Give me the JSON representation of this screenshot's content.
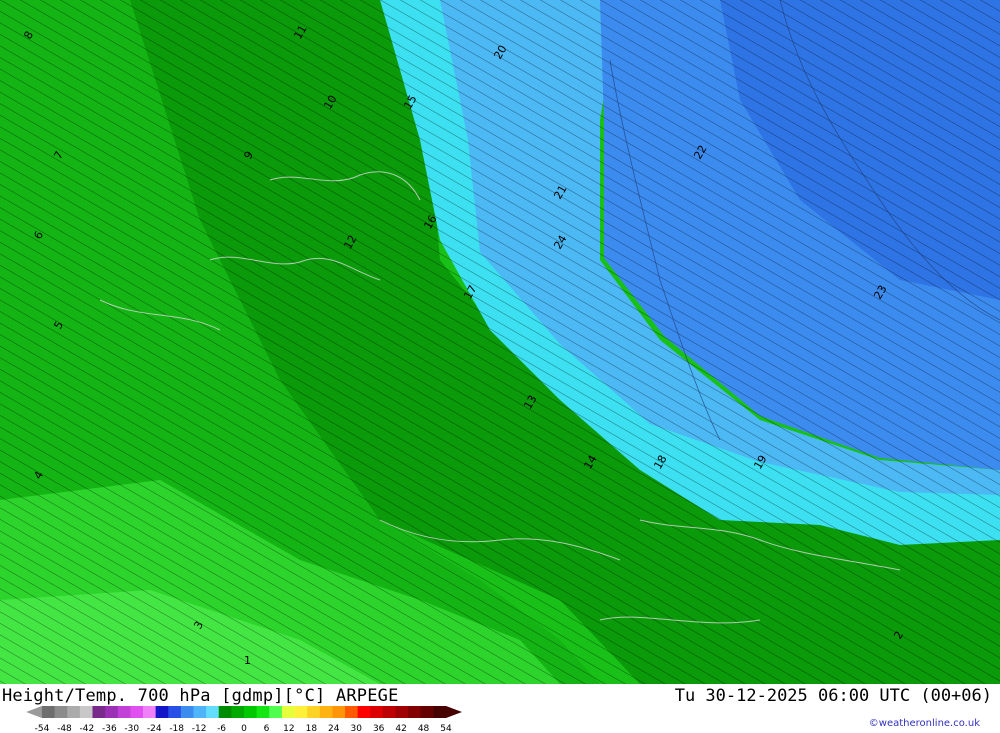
{
  "map": {
    "contour_labels_west": [
      "1",
      "2",
      "3",
      "4",
      "5",
      "6",
      "7",
      "8",
      "9",
      "10",
      "11",
      "12",
      "13",
      "14"
    ],
    "contour_labels_east": [
      "15",
      "16",
      "17",
      "18",
      "19",
      "20",
      "21",
      "22",
      "23",
      "24"
    ]
  },
  "footer": {
    "title": "Height/Temp. 700 hPa [gdmp][°C] ARPEGE",
    "datetime": "Tu 30-12-2025 06:00 UTC (00+06)",
    "credit": "©weatheronline.co.uk"
  },
  "legend": {
    "ticks": [
      "-54",
      "-48",
      "-42",
      "-36",
      "-30",
      "-24",
      "-18",
      "-12",
      "-6",
      "0",
      "6",
      "12",
      "18",
      "24",
      "30",
      "36",
      "42",
      "48",
      "54"
    ],
    "colors": [
      "#6e6e6e",
      "#8c8c8c",
      "#aaaaaa",
      "#c8c8c8",
      "#7a2a8a",
      "#9a30b4",
      "#c040d8",
      "#e050f0",
      "#f080f8",
      "#1414c8",
      "#2850e6",
      "#3c8cf0",
      "#50b4f8",
      "#64dcfc",
      "#008c00",
      "#00aa00",
      "#00c800",
      "#14e614",
      "#50ff50",
      "#e6ff3c",
      "#fff03c",
      "#ffd228",
      "#ffb414",
      "#ff960a",
      "#ff5a00",
      "#ff0000",
      "#dc0000",
      "#be0000",
      "#a00000",
      "#820000",
      "#640000",
      "#460000"
    ]
  }
}
